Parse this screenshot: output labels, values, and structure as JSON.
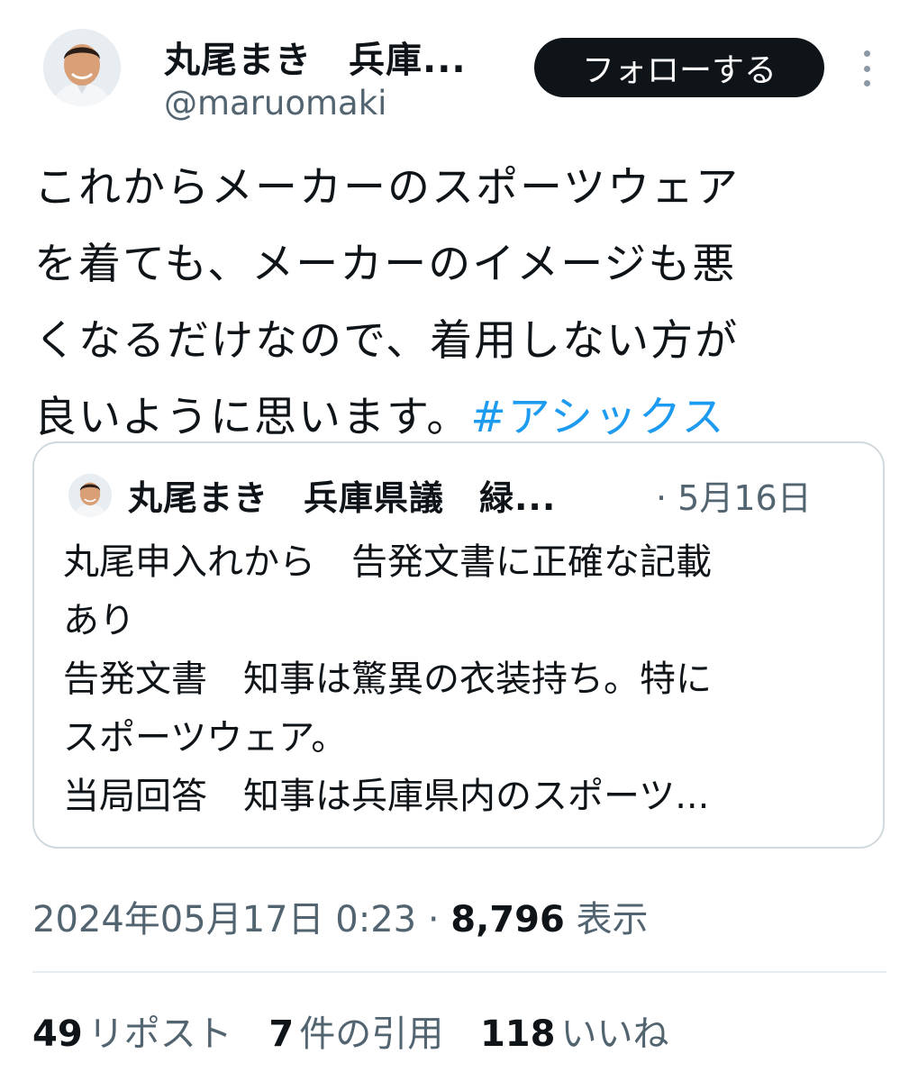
{
  "author": {
    "name": "丸尾まき　兵庫...",
    "handle": "@maruomaki",
    "follow_label": "フォローする"
  },
  "tweet": {
    "lines": [
      "これからメーカーのスポーツウェア",
      "を着ても、メーカーのイメージも悪",
      "くなるだけなので、着用しない方が",
      "良いように思います。"
    ],
    "hashtag": "#アシックス"
  },
  "quote": {
    "name": "丸尾まき　兵庫県議　緑...",
    "date": "· 5月16日",
    "lines": [
      "丸尾申入れから　告発文書に正確な記載",
      "あり",
      "告発文書　知事は驚異の衣装持ち。特に",
      "スポーツウェア。",
      "当局回答　知事は兵庫県内のスポーツ..."
    ]
  },
  "meta": {
    "timestamp": "2024年05月17日 0:23 · ",
    "views": "8,796",
    "views_label": "表示"
  },
  "stats": {
    "reposts": "49",
    "reposts_label": "リポスト",
    "quotes": "7",
    "quotes_label": "件の引用",
    "likes": "118",
    "likes_label": "いいね"
  }
}
